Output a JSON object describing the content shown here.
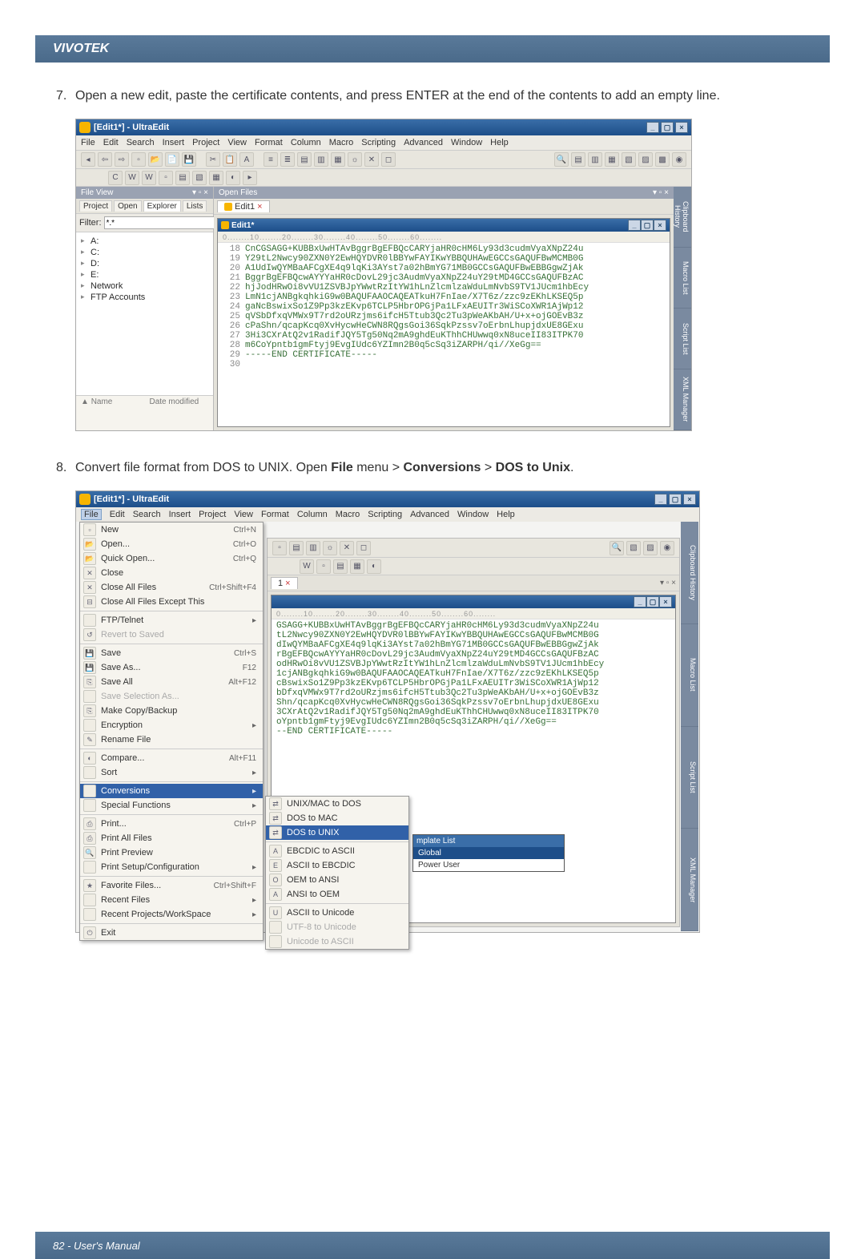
{
  "brand": "VIVOTEK",
  "step7_num": "7.",
  "step7_text": "Open a new edit, paste the certificate contents, and press ENTER at the end of the contents to add an empty line.",
  "step8_num": "8.",
  "step8_text_a": "Convert file format from DOS to UNIX. Open ",
  "step8_file": "File",
  "step8_text_b": " menu > ",
  "step8_conv": "Conversions",
  "step8_text_c": " > ",
  "step8_dos": "DOS to Unix",
  "step8_text_d": ".",
  "footer": "82 - User's Manual",
  "shot1": {
    "title": "[Edit1*] - UltraEdit",
    "menu": [
      "File",
      "Edit",
      "Search",
      "Insert",
      "Project",
      "View",
      "Format",
      "Column",
      "Macro",
      "Scripting",
      "Advanced",
      "Window",
      "Help"
    ],
    "fileview_hdr": "File View",
    "side_tabs": [
      "Project",
      "Open",
      "Explorer",
      "Lists"
    ],
    "filter_label": "Filter:",
    "filter_value": "*.*",
    "tree": [
      "A:",
      "C:",
      "D:",
      "E:",
      "Network",
      "FTP Accounts"
    ],
    "bottom_hdr": [
      "Name",
      "Date modified"
    ],
    "openfiles_hdr": "Open Files",
    "tab": "Edit1",
    "innerwin": "Edit1*",
    "ruler": "0........10........20........30........40........50........60........",
    "code": [
      {
        "n": "18",
        "t": "CnCGSAGG+KUBBxUwHTAvBggrBgEFBQcCARYjaHR0cHM6Ly93d3cudmVyaXNpZ24u"
      },
      {
        "n": "19",
        "t": "Y29tL2Nwcy90ZXN0Y2EwHQYDVR0lBBYwFAYIKwYBBQUHAwEGCCsGAQUFBwMCMB0G"
      },
      {
        "n": "20",
        "t": "A1UdIwQYMBaAFCgXE4q9lqKi3AYst7a02hBmYG71MB0GCCsGAQUFBwEBBGgwZjAk"
      },
      {
        "n": "21",
        "t": "BggrBgEFBQcwAYYYaHR0cDovL29jc3AudmVyaXNpZ24uY29tMD4GCCsGAQUFBzAC"
      },
      {
        "n": "22",
        "t": "hjJodHRwOi8vVU1ZSVBJpYWwtRzItYW1hLnZlcmlzaWduLmNvbS9TV1JUcm1hbEcy"
      },
      {
        "n": "23",
        "t": "LmN1cjANBgkqhkiG9w0BAQUFAAOCAQEATkuH7FnIae/X7T6z/zzc9zEKhLKSEQ5p"
      },
      {
        "n": "24",
        "t": "gaNcBswixSo1Z9Pp3kzEKvp6TCLP5HbrOPGjPa1LFxAEUITr3WiSCoXWR1AjWp12"
      },
      {
        "n": "25",
        "t": "qVSbDfxqVMWx9T7rd2oURzjms6ifcH5Ttub3Qc2Tu3pWeAKbAH/U+x+ojGOEvB3z"
      },
      {
        "n": "26",
        "t": "cPaShn/qcapKcq0XvHycwHeCWN8RQgsGoi36SqkPzssv7oErbnLhupjdxUE8GExu"
      },
      {
        "n": "27",
        "t": "3Hi3CXrAtQ2v1RadifJQY5Tg50Nq2mA9ghdEuKThhCHUwwq0xN8uceII83ITPK70"
      },
      {
        "n": "28",
        "t": "m6CoYpntb1gmFtyj9EvgIUdc6YZImn2B0q5cSq3iZARPH/qi//XeGg=="
      },
      {
        "n": "29",
        "t": "-----END CERTIFICATE-----"
      },
      {
        "n": "30",
        "t": ""
      }
    ],
    "rtabs": [
      "Clipboard History",
      "Macro List",
      "Script List",
      "XML Manager"
    ]
  },
  "shot2": {
    "title": "[Edit1*] - UltraEdit",
    "menu": [
      "File",
      "Edit",
      "Search",
      "Insert",
      "Project",
      "View",
      "Format",
      "Column",
      "Macro",
      "Scripting",
      "Advanced",
      "Window",
      "Help"
    ],
    "filemenu": [
      {
        "l": "New",
        "sc": "Ctrl+N",
        "ic": "▫"
      },
      {
        "l": "Open...",
        "sc": "Ctrl+O",
        "ic": "📂"
      },
      {
        "l": "Quick Open...",
        "sc": "Ctrl+Q",
        "ic": "📂"
      },
      {
        "l": "Close",
        "sc": "",
        "ic": "✕"
      },
      {
        "l": "Close All Files",
        "sc": "Ctrl+Shift+F4",
        "ic": "✕"
      },
      {
        "l": "Close All Files Except This",
        "sc": "",
        "ic": "⊟"
      },
      {
        "l": "FTP/Telnet",
        "sc": "",
        "ic": "",
        "sub": true
      },
      {
        "l": "Revert to Saved",
        "sc": "",
        "ic": "↺",
        "dis": true
      },
      {
        "l": "Save",
        "sc": "Ctrl+S",
        "ic": "💾"
      },
      {
        "l": "Save As...",
        "sc": "F12",
        "ic": "💾"
      },
      {
        "l": "Save All",
        "sc": "Alt+F12",
        "ic": "⎘"
      },
      {
        "l": "Save Selection As...",
        "sc": "",
        "ic": "",
        "dis": true
      },
      {
        "l": "Make Copy/Backup",
        "sc": "",
        "ic": "⎘"
      },
      {
        "l": "Encryption",
        "sc": "",
        "ic": "",
        "sub": true
      },
      {
        "l": "Rename File",
        "sc": "",
        "ic": "✎"
      },
      {
        "l": "Compare...",
        "sc": "Alt+F11",
        "ic": "◐"
      },
      {
        "l": "Sort",
        "sc": "",
        "ic": "",
        "sub": true
      },
      {
        "l": "Conversions",
        "sc": "",
        "ic": "",
        "sub": true,
        "hi": true
      },
      {
        "l": "Special Functions",
        "sc": "",
        "ic": "",
        "sub": true
      },
      {
        "l": "Print...",
        "sc": "Ctrl+P",
        "ic": "⎙"
      },
      {
        "l": "Print All Files",
        "sc": "",
        "ic": "⎙"
      },
      {
        "l": "Print Preview",
        "sc": "",
        "ic": "🔍"
      },
      {
        "l": "Print Setup/Configuration",
        "sc": "",
        "ic": "",
        "sub": true
      },
      {
        "l": "Favorite Files...",
        "sc": "Ctrl+Shift+F",
        "ic": "★"
      },
      {
        "l": "Recent Files",
        "sc": "",
        "ic": "",
        "sub": true
      },
      {
        "l": "Recent Projects/WorkSpace",
        "sc": "",
        "ic": "",
        "sub": true
      },
      {
        "l": "Exit",
        "sc": "",
        "ic": "⏻"
      }
    ],
    "submenu": [
      {
        "l": "UNIX/MAC to DOS",
        "ic": "⇄"
      },
      {
        "l": "DOS to MAC",
        "ic": "⇄"
      },
      {
        "l": "DOS to UNIX",
        "ic": "⇄",
        "hi": true
      },
      {
        "l": "EBCDIC to ASCII",
        "ic": "A"
      },
      {
        "l": "ASCII to EBCDIC",
        "ic": "E"
      },
      {
        "l": "OEM to ANSI",
        "ic": "O"
      },
      {
        "l": "ANSI to OEM",
        "ic": "A"
      },
      {
        "l": "ASCII to Unicode",
        "ic": "U"
      },
      {
        "l": "UTF-8 to Unicode",
        "ic": "",
        "dis": true
      },
      {
        "l": "Unicode to ASCII",
        "ic": "",
        "dis": true
      }
    ],
    "dropdown": {
      "hdr": "mplate List",
      "items": [
        "Global",
        "Power User"
      ]
    },
    "tab": "1",
    "ruler": "0........10........20........30........40........50........60........",
    "code": [
      "GSAGG+KUBBxUwHTAvBggrBgEFBQcCARYjaHR0cHM6Ly93d3cudmVyaXNpZ24u",
      "tL2Nwcy90ZXN0Y2EwHQYDVR0lBBYwFAYIKwYBBQUHAwEGCCsGAQUFBwMCMB0G",
      "dIwQYMBaAFCgXE4q9lqKi3AYst7a02hBmYG71MB0GCCsGAQUFBwEBBGgwZjAk",
      "rBgEFBQcwAYYYaHR0cDovL29jc3AudmVyaXNpZ24uY29tMD4GCCsGAQUFBzAC",
      "odHRwOi8vVU1ZSVBJpYWwtRzItYW1hLnZlcmlzaWduLmNvbS9TV1JUcm1hbEcy",
      "1cjANBgkqhkiG9w0BAQUFAAOCAQEATkuH7FnIae/X7T6z/zzc9zEKhLKSEQ5p",
      "cBswixSo1Z9Pp3kzEKvp6TCLP5HbrOPGjPa1LFxAEUITr3WiSCoXWR1AjWp12",
      "bDfxqVMWx9T7rd2oURzjms6ifcH5Ttub3Qc2Tu3pWeAKbAH/U+x+ojGOEvB3z",
      "Shn/qcapKcq0XvHycwHeCWN8RQgsGoi36SqkPzssv7oErbnLhupjdxUE8GExu",
      "3CXrAtQ2v1RadifJQY5Tg50Nq2mA9ghdEuKThhCHUwwq0xN8uceII83ITPK70",
      "oYpntb1gmFtyj9EvgIUdc6YZImn2B0q5cSq3iZARPH/qi//XeGg==",
      "--END CERTIFICATE-----"
    ],
    "rtabs": [
      "Clipboard History",
      "Macro List",
      "Script List",
      "XML Manager"
    ]
  }
}
